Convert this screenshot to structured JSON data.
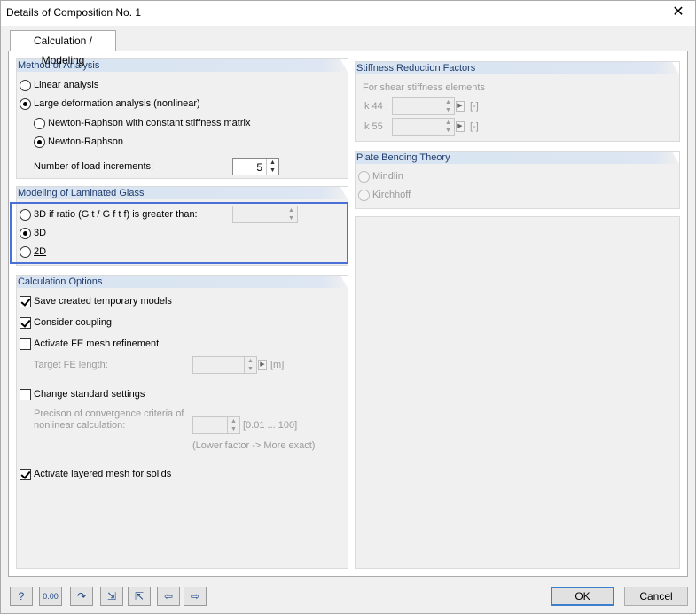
{
  "window": {
    "title": "Details of Composition No. 1"
  },
  "tab": {
    "label": "Calculation / Modeling"
  },
  "method": {
    "title": "Method of Analysis",
    "linear": "Linear analysis",
    "large": "Large deformation analysis (nonlinear)",
    "nr_const": "Newton-Raphson with constant stiffness matrix",
    "nr": "Newton-Raphson",
    "load_inc_label": "Number of load increments:",
    "load_inc_value": "5"
  },
  "laminated": {
    "title": "Modeling of Laminated Glass",
    "ratio_label": "3D if ratio (G t / G f t f) is greater than:",
    "opt_3d": "3D",
    "opt_2d": "2D"
  },
  "calc": {
    "title": "Calculation Options",
    "save_temp": "Save created temporary models",
    "coupling": "Consider coupling",
    "fe_refine": "Activate FE mesh refinement",
    "target_fe": "Target FE length:",
    "target_unit": "[m]",
    "change_std": "Change standard settings",
    "precision_line1": "Precison of convergence criteria of",
    "precision_line2": "nonlinear calculation:",
    "precision_range": "[0.01 ... 100]",
    "precision_hint": "(Lower factor -> More exact)",
    "layered": "Activate layered mesh for solids"
  },
  "stiffness": {
    "title": "Stiffness Reduction Factors",
    "subtitle": "For shear stiffness elements",
    "k44": "k 44 :",
    "k55": "k 55 :",
    "unit": "[-]"
  },
  "plate": {
    "title": "Plate Bending Theory",
    "mindlin": "Mindlin",
    "kirchhoff": "Kirchhoff"
  },
  "buttons": {
    "ok": "OK",
    "cancel": "Cancel"
  },
  "toolbar": {
    "numeric_label": "0.00"
  }
}
